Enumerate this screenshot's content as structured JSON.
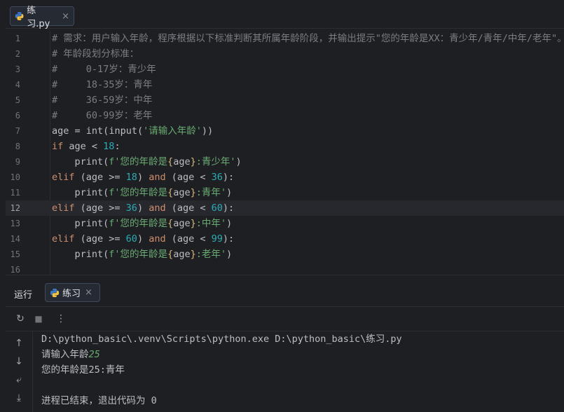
{
  "editor": {
    "tab": {
      "filename": "练习.py",
      "icon": "python-file-icon",
      "close": "×"
    },
    "current_line": 12,
    "lines": [
      {
        "n": "1",
        "segs": [
          {
            "t": "# 需求：用户输入年龄，程序根据以下标准判断其所属年龄阶段，并输出提示\"您的年龄是XX：青少年/青年/中年/老年\"。",
            "c": "cm"
          }
        ]
      },
      {
        "n": "2",
        "segs": [
          {
            "t": "# 年龄段划分标准：",
            "c": "cm"
          }
        ]
      },
      {
        "n": "3",
        "segs": [
          {
            "t": "#     0-17岁：青少年",
            "c": "cm"
          }
        ]
      },
      {
        "n": "4",
        "segs": [
          {
            "t": "#     18-35岁：青年",
            "c": "cm"
          }
        ]
      },
      {
        "n": "5",
        "segs": [
          {
            "t": "#     36-59岁：中年",
            "c": "cm"
          }
        ]
      },
      {
        "n": "6",
        "segs": [
          {
            "t": "#     60-99岁：老年",
            "c": "cm"
          }
        ]
      },
      {
        "n": "7",
        "segs": [
          {
            "t": "age = ",
            "c": ""
          },
          {
            "t": "int",
            "c": "fn"
          },
          {
            "t": "(",
            "c": ""
          },
          {
            "t": "input",
            "c": "fn"
          },
          {
            "t": "(",
            "c": ""
          },
          {
            "t": "'请输入年龄'",
            "c": "str"
          },
          {
            "t": "))",
            "c": ""
          }
        ]
      },
      {
        "n": "8",
        "segs": [
          {
            "t": "if",
            "c": "kw"
          },
          {
            "t": " age < ",
            "c": ""
          },
          {
            "t": "18",
            "c": "num"
          },
          {
            "t": ":",
            "c": ""
          }
        ]
      },
      {
        "n": "9",
        "segs": [
          {
            "t": "    print(",
            "c": ""
          },
          {
            "t": "f'您的年龄是",
            "c": "str"
          },
          {
            "t": "{",
            "c": "br"
          },
          {
            "t": "age",
            "c": ""
          },
          {
            "t": "}",
            "c": "br"
          },
          {
            "t": ":青少年'",
            "c": "str"
          },
          {
            "t": ")",
            "c": ""
          }
        ]
      },
      {
        "n": "10",
        "segs": [
          {
            "t": "elif",
            "c": "kw"
          },
          {
            "t": " (age >= ",
            "c": ""
          },
          {
            "t": "18",
            "c": "num"
          },
          {
            "t": ") ",
            "c": ""
          },
          {
            "t": "and",
            "c": "kw"
          },
          {
            "t": " (age < ",
            "c": ""
          },
          {
            "t": "36",
            "c": "num"
          },
          {
            "t": "):",
            "c": ""
          }
        ]
      },
      {
        "n": "11",
        "segs": [
          {
            "t": "    print(",
            "c": ""
          },
          {
            "t": "f'您的年龄是",
            "c": "str"
          },
          {
            "t": "{",
            "c": "br"
          },
          {
            "t": "age",
            "c": ""
          },
          {
            "t": "}",
            "c": "br"
          },
          {
            "t": ":青年'",
            "c": "str"
          },
          {
            "t": ")",
            "c": ""
          }
        ]
      },
      {
        "n": "12",
        "segs": [
          {
            "t": "elif",
            "c": "kw"
          },
          {
            "t": " (age >= ",
            "c": ""
          },
          {
            "t": "36",
            "c": "num"
          },
          {
            "t": ") ",
            "c": ""
          },
          {
            "t": "and",
            "c": "kw"
          },
          {
            "t": " (age < ",
            "c": ""
          },
          {
            "t": "60",
            "c": "num"
          },
          {
            "t": "):",
            "c": ""
          }
        ]
      },
      {
        "n": "13",
        "segs": [
          {
            "t": "    print(",
            "c": ""
          },
          {
            "t": "f'您的年龄是",
            "c": "str"
          },
          {
            "t": "{",
            "c": "br"
          },
          {
            "t": "age",
            "c": ""
          },
          {
            "t": "}",
            "c": "br"
          },
          {
            "t": ":中年'",
            "c": "str"
          },
          {
            "t": ")",
            "c": ""
          }
        ]
      },
      {
        "n": "14",
        "segs": [
          {
            "t": "elif",
            "c": "kw"
          },
          {
            "t": " (age >= ",
            "c": ""
          },
          {
            "t": "60",
            "c": "num"
          },
          {
            "t": ") ",
            "c": ""
          },
          {
            "t": "and",
            "c": "kw"
          },
          {
            "t": " (age < ",
            "c": ""
          },
          {
            "t": "99",
            "c": "num"
          },
          {
            "t": "):",
            "c": ""
          }
        ]
      },
      {
        "n": "15",
        "segs": [
          {
            "t": "    print(",
            "c": ""
          },
          {
            "t": "f'您的年龄是",
            "c": "str"
          },
          {
            "t": "{",
            "c": "br"
          },
          {
            "t": "age",
            "c": ""
          },
          {
            "t": "}",
            "c": "br"
          },
          {
            "t": ":老年'",
            "c": "str"
          },
          {
            "t": ")",
            "c": ""
          }
        ]
      },
      {
        "n": "16",
        "segs": []
      }
    ]
  },
  "run": {
    "title": "运行",
    "tab": {
      "label": "练习",
      "icon": "python-file-icon",
      "close": "×"
    },
    "toolbar": [
      {
        "name": "rerun-icon",
        "glyph": "↻"
      },
      {
        "name": "stop-icon",
        "glyph": "■"
      },
      {
        "name": "more-options-icon",
        "glyph": "⋮"
      }
    ],
    "side_tools": [
      {
        "name": "scroll-up-icon",
        "glyph": "↑"
      },
      {
        "name": "scroll-down-icon",
        "glyph": "↓"
      },
      {
        "name": "soft-wrap-icon",
        "glyph": "⤶"
      },
      {
        "name": "scroll-to-end-icon",
        "glyph": "⤓"
      }
    ],
    "console": {
      "command": "D:\\python_basic\\.venv\\Scripts\\python.exe D:\\python_basic\\练习.py",
      "prompt": "请输入年龄",
      "input_value": "25",
      "output": "您的年龄是25:青年",
      "blank": "",
      "exit": "进程已结束，退出代码为 0"
    }
  }
}
